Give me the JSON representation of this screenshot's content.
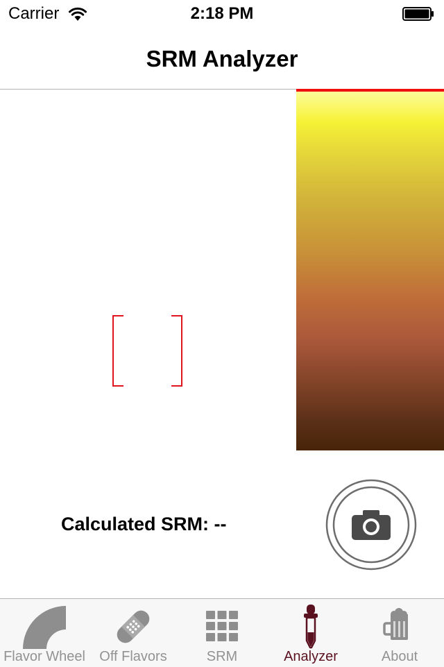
{
  "status_bar": {
    "carrier": "Carrier",
    "time": "2:18 PM",
    "icons": [
      "wifi-icon",
      "battery-icon"
    ]
  },
  "nav": {
    "title": "SRM Analyzer"
  },
  "analyzer": {
    "calculated_label": "Calculated SRM: --",
    "capture_icon": "camera-icon",
    "scale_colors": [
      "#fdfda0",
      "#f6f236",
      "#e6d83a",
      "#d2b43a",
      "#c89138",
      "#bf6c39",
      "#a8573a",
      "#7f4227",
      "#5a3018",
      "#482407"
    ],
    "indicator_color": "#f00f0f",
    "reticle_color": "#e0141e"
  },
  "tabs": [
    {
      "label": "Flavor Wheel",
      "icon": "flavor-wheel-icon",
      "active": false
    },
    {
      "label": "Off Flavors",
      "icon": "bandage-icon",
      "active": false
    },
    {
      "label": "SRM",
      "icon": "grid-icon",
      "active": false
    },
    {
      "label": "Analyzer",
      "icon": "dropper-icon",
      "active": true
    },
    {
      "label": "About",
      "icon": "beer-mug-icon",
      "active": false
    }
  ],
  "colors": {
    "tab_active": "#5b1220",
    "tab_inactive": "#929292",
    "icon_gray": "#8e8e8e"
  }
}
